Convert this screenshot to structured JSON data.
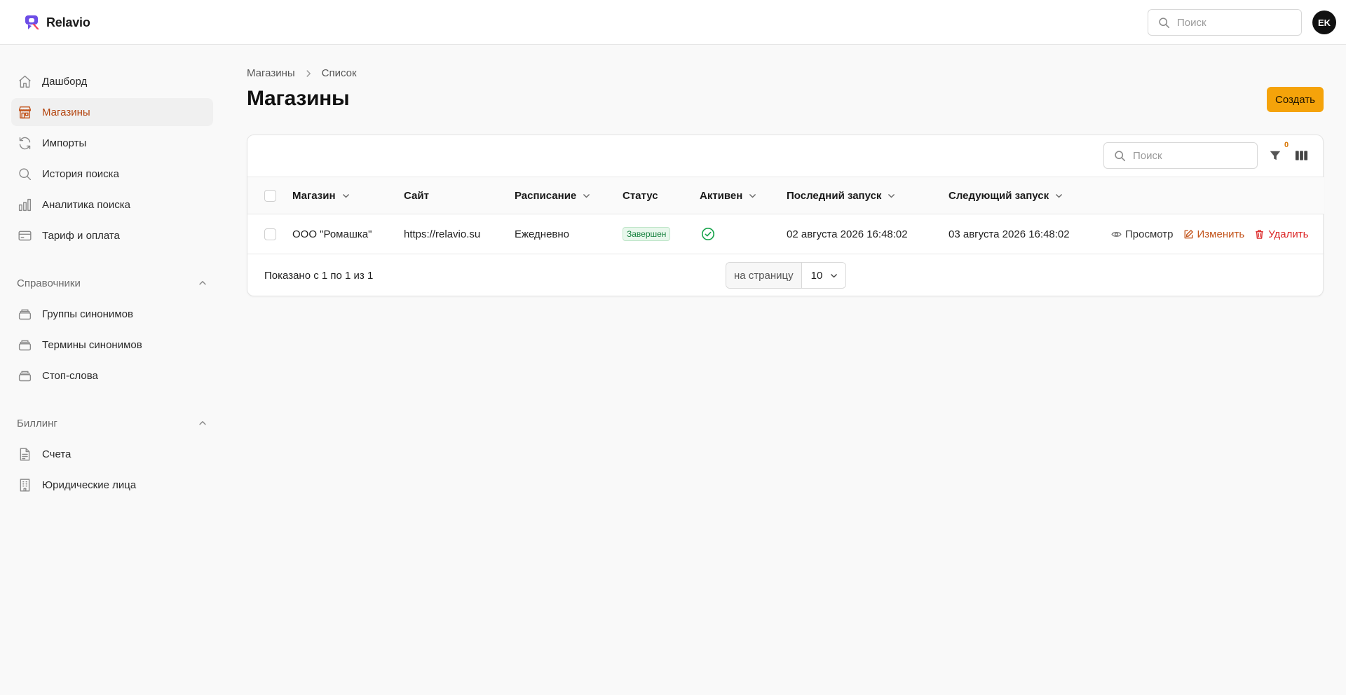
{
  "app": {
    "name": "Relavio",
    "accent": "#f5a30a",
    "active_color": "#c2531a"
  },
  "header": {
    "search_placeholder": "Поиск",
    "avatar_initials": "EK"
  },
  "sidebar": {
    "items": [
      {
        "label": "Дашборд",
        "icon": "home-icon"
      },
      {
        "label": "Магазины",
        "icon": "store-icon",
        "active": true
      },
      {
        "label": "Импорты",
        "icon": "refresh-icon"
      },
      {
        "label": "История поиска",
        "icon": "search-icon"
      },
      {
        "label": "Аналитика поиска",
        "icon": "bar-chart-icon"
      },
      {
        "label": "Тариф и оплата",
        "icon": "credit-card-icon"
      }
    ],
    "groups": [
      {
        "label": "Справочники",
        "items": [
          {
            "label": "Группы синонимов",
            "icon": "stack-icon"
          },
          {
            "label": "Термины синонимов",
            "icon": "stack-icon"
          },
          {
            "label": "Стоп-слова",
            "icon": "stack-icon"
          }
        ]
      },
      {
        "label": "Биллинг",
        "items": [
          {
            "label": "Счета",
            "icon": "document-icon"
          },
          {
            "label": "Юридические лица",
            "icon": "building-icon"
          }
        ]
      }
    ]
  },
  "breadcrumb": {
    "items": [
      "Магазины",
      "Список"
    ]
  },
  "page": {
    "title": "Магазины",
    "create_label": "Создать"
  },
  "table": {
    "search_placeholder": "Поиск",
    "filter_count": "0",
    "columns": [
      "Магазин",
      "Сайт",
      "Расписание",
      "Статус",
      "Активен",
      "Последний запуск",
      "Следующий запуск"
    ],
    "rows": [
      {
        "shop": "ООО \"Ромашка\"",
        "site": "https://relavio.su",
        "schedule": "Ежедневно",
        "status": "Завершен",
        "active": true,
        "last_run": "02 августа 2026 16:48:02",
        "next_run": "03 августа 2026 16:48:02"
      }
    ],
    "actions": {
      "view": "Просмотр",
      "edit": "Изменить",
      "delete": "Удалить"
    }
  },
  "pagination": {
    "shown_text": "Показано с 1 по 1 из 1",
    "per_page_label": "на страницу",
    "per_page_value": "10"
  }
}
